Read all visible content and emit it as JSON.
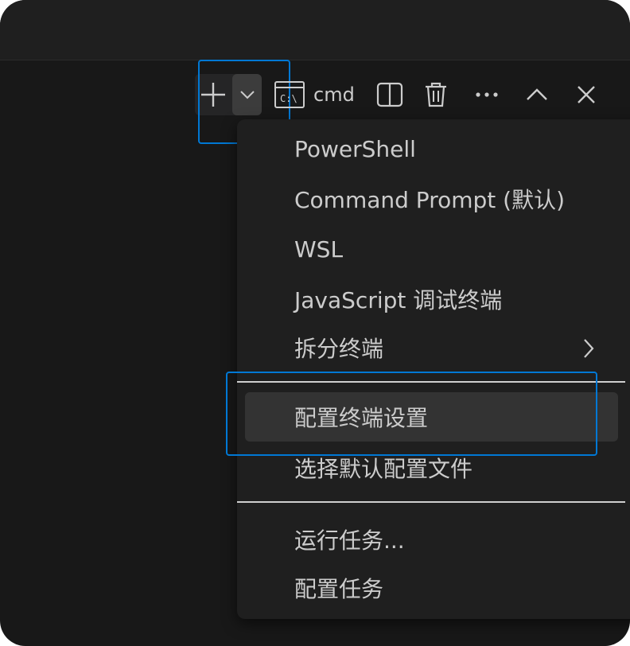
{
  "colors": {
    "background": "#181818",
    "menu_background": "#1f1f1f",
    "active_item": "#333333",
    "focus_border": "#0078d4",
    "text": "#cccccc"
  },
  "toolbar": {
    "new_terminal_icon": "plus-icon",
    "profiles_icon": "chevron-down-icon",
    "terminal_icon": "terminal-icon",
    "terminal_label": "cmd",
    "split_icon": "split-icon",
    "kill_icon": "trash-icon",
    "more_icon": "more-icon",
    "maximize_icon": "chevron-up-icon",
    "close_icon": "close-icon"
  },
  "menu": {
    "profiles": [
      {
        "label": "PowerShell"
      },
      {
        "label": "Command Prompt (默认)"
      },
      {
        "label": "WSL"
      },
      {
        "label": "JavaScript 调试终端"
      }
    ],
    "split_terminal": {
      "label": "拆分终端",
      "icon": "chevron-right-icon"
    },
    "configure_group": [
      {
        "label": "配置终端设置",
        "active": true
      },
      {
        "label": "选择默认配置文件"
      }
    ],
    "task_group": [
      {
        "label": "运行任务..."
      },
      {
        "label": "配置任务"
      }
    ]
  }
}
